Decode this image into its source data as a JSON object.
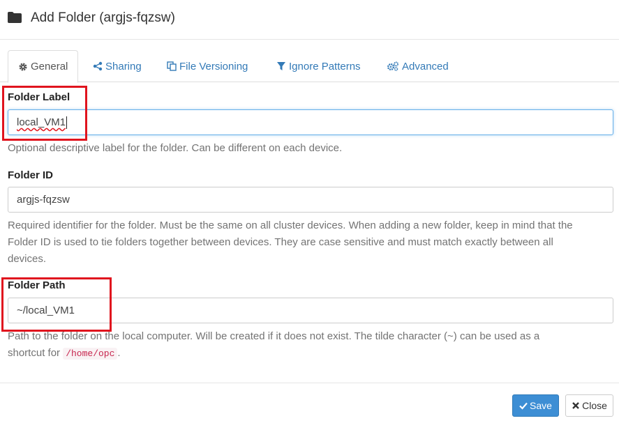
{
  "header": {
    "title": "Add Folder (argjs-fqzsw)",
    "icon": "folder-icon"
  },
  "tabs": [
    {
      "label": "General",
      "icon": "gear-icon",
      "active": true
    },
    {
      "label": "Sharing",
      "icon": "share-icon"
    },
    {
      "label": "File Versioning",
      "icon": "copy-icon"
    },
    {
      "label": "Ignore Patterns",
      "icon": "filter-icon"
    },
    {
      "label": "Advanced",
      "icon": "cogs-icon"
    }
  ],
  "form": {
    "folder_label": {
      "label": "Folder Label",
      "value": "local_VM1",
      "help": "Optional descriptive label for the folder. Can be different on each device."
    },
    "folder_id": {
      "label": "Folder ID",
      "value": "argjs-fqzsw",
      "help_line1": "Required identifier for the folder. Must be the same on all cluster devices. When adding a new folder, keep in mind that the",
      "help_line2": "Folder ID is used to tie folders together between devices. They are case sensitive and must match exactly between all",
      "help_line3": "devices."
    },
    "folder_path": {
      "label": "Folder Path",
      "value": "~/local_VM1",
      "help_line1": "Path to the folder on the local computer. Will be created if it does not exist. The tilde character (~) can be used as a",
      "help_prefix": "shortcut for ",
      "help_code": "/home/opc",
      "help_suffix": "."
    }
  },
  "footer": {
    "save_label": "Save",
    "close_label": "Close"
  },
  "colors": {
    "link": "#337ab7",
    "highlight": "#e0141e",
    "primary": "#3d8ed4"
  }
}
